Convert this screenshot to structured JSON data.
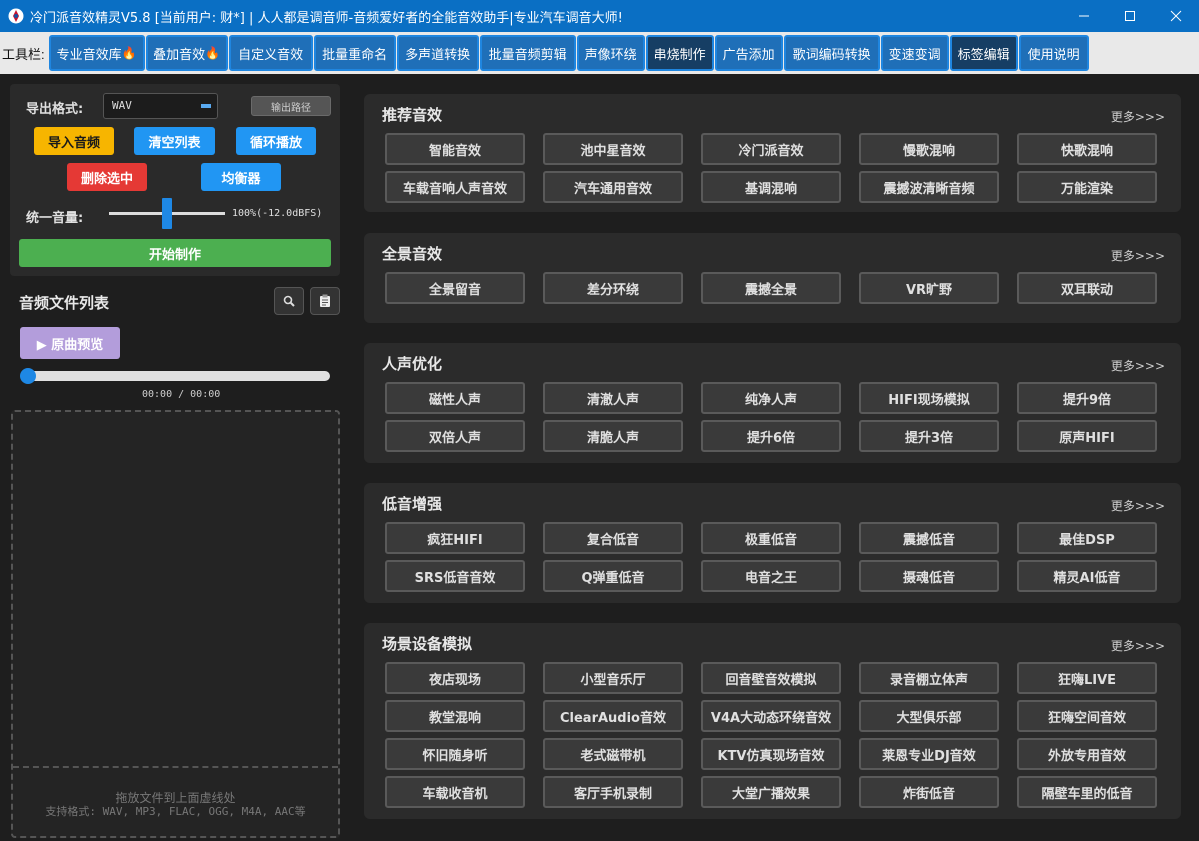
{
  "window": {
    "title": "冷门派音效精灵V5.8 [当前用户: 财*] | 人人都是调音师-音频爱好者的全能音效助手|专业汽车调音大师!"
  },
  "toolbar": {
    "label": "工具栏:",
    "items": [
      {
        "label": "专业音效库",
        "fire": "🔥"
      },
      {
        "label": "叠加音效",
        "fire": "🔥"
      },
      {
        "label": "自定义音效"
      },
      {
        "label": "批量重命名"
      },
      {
        "label": "多声道转换"
      },
      {
        "label": "批量音频剪辑"
      },
      {
        "label": "声像环绕"
      },
      {
        "label": "串烧制作"
      },
      {
        "label": "广告添加"
      },
      {
        "label": "歌词编码转换"
      },
      {
        "label": "变速变调"
      },
      {
        "label": "标签编辑"
      },
      {
        "label": "使用说明"
      }
    ]
  },
  "left": {
    "export_label": "导出格式:",
    "export_value": "WAV",
    "output_path": "输出路径",
    "import": "导入音频",
    "clear": "清空列表",
    "loop": "循环播放",
    "delete": "删除选中",
    "eq": "均衡器",
    "volume_label": "统一音量:",
    "volume_text": "100%(-12.0dBFS)",
    "volume_level": 0.5,
    "start": "开始制作",
    "list_title": "音频文件列表",
    "preview": "▶ 原曲预览",
    "time": "00:00 / 00:00",
    "drop1": "拖放文件到上面虚线处",
    "drop2": "支持格式: WAV, MP3, FLAC, OGG, M4A, AAC等"
  },
  "more": "更多>>>",
  "sections": [
    {
      "title": "推荐音效",
      "items": [
        "智能音效",
        "池中星音效",
        "冷门派音效",
        "慢歌混响",
        "快歌混响",
        "车载音响人声音效",
        "汽车通用音效",
        "基调混响",
        "震撼波清晰音频",
        "万能渲染"
      ]
    },
    {
      "title": "全景音效",
      "items": [
        "全景留音",
        "差分环绕",
        "震撼全景",
        "VR旷野",
        "双耳联动"
      ]
    },
    {
      "title": "人声优化",
      "items": [
        "磁性人声",
        "清澈人声",
        "纯净人声",
        "HIFI现场模拟",
        "提升9倍",
        "双倍人声",
        "清脆人声",
        "提升6倍",
        "提升3倍",
        "原声HIFI"
      ]
    },
    {
      "title": "低音增强",
      "items": [
        "疯狂HIFI",
        "复合低音",
        "极重低音",
        "震撼低音",
        "最佳DSP",
        "SRS低音音效",
        "Q弹重低音",
        "电音之王",
        "摄魂低音",
        "精灵AI低音"
      ]
    },
    {
      "title": "场景设备模拟",
      "items": [
        "夜店现场",
        "小型音乐厅",
        "回音壁音效模拟",
        "录音棚立体声",
        "狂嗨LIVE",
        "教堂混响",
        "ClearAudio音效",
        "V4A大动态环绕音效",
        "大型俱乐部",
        "狂嗨空间音效",
        "怀旧随身听",
        "老式磁带机",
        "KTV仿真现场音效",
        "莱恩专业DJ音效",
        "外放专用音效",
        "车载收音机",
        "客厅手机录制",
        "大堂广播效果",
        "炸街低音",
        "隔壁车里的低音"
      ]
    }
  ]
}
